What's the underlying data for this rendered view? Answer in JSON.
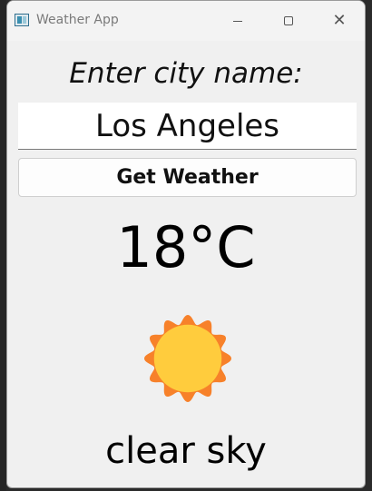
{
  "window": {
    "title": "Weather App"
  },
  "form": {
    "prompt": "Enter city name:",
    "city_value": "Los Angeles",
    "button_label": "Get Weather"
  },
  "weather": {
    "temperature": "18°C",
    "description": "clear sky",
    "icon": "sun-icon"
  },
  "colors": {
    "sun_outer": "#f7812a",
    "sun_inner": "#ffcc3d",
    "window_bg": "#f0f0f0"
  }
}
